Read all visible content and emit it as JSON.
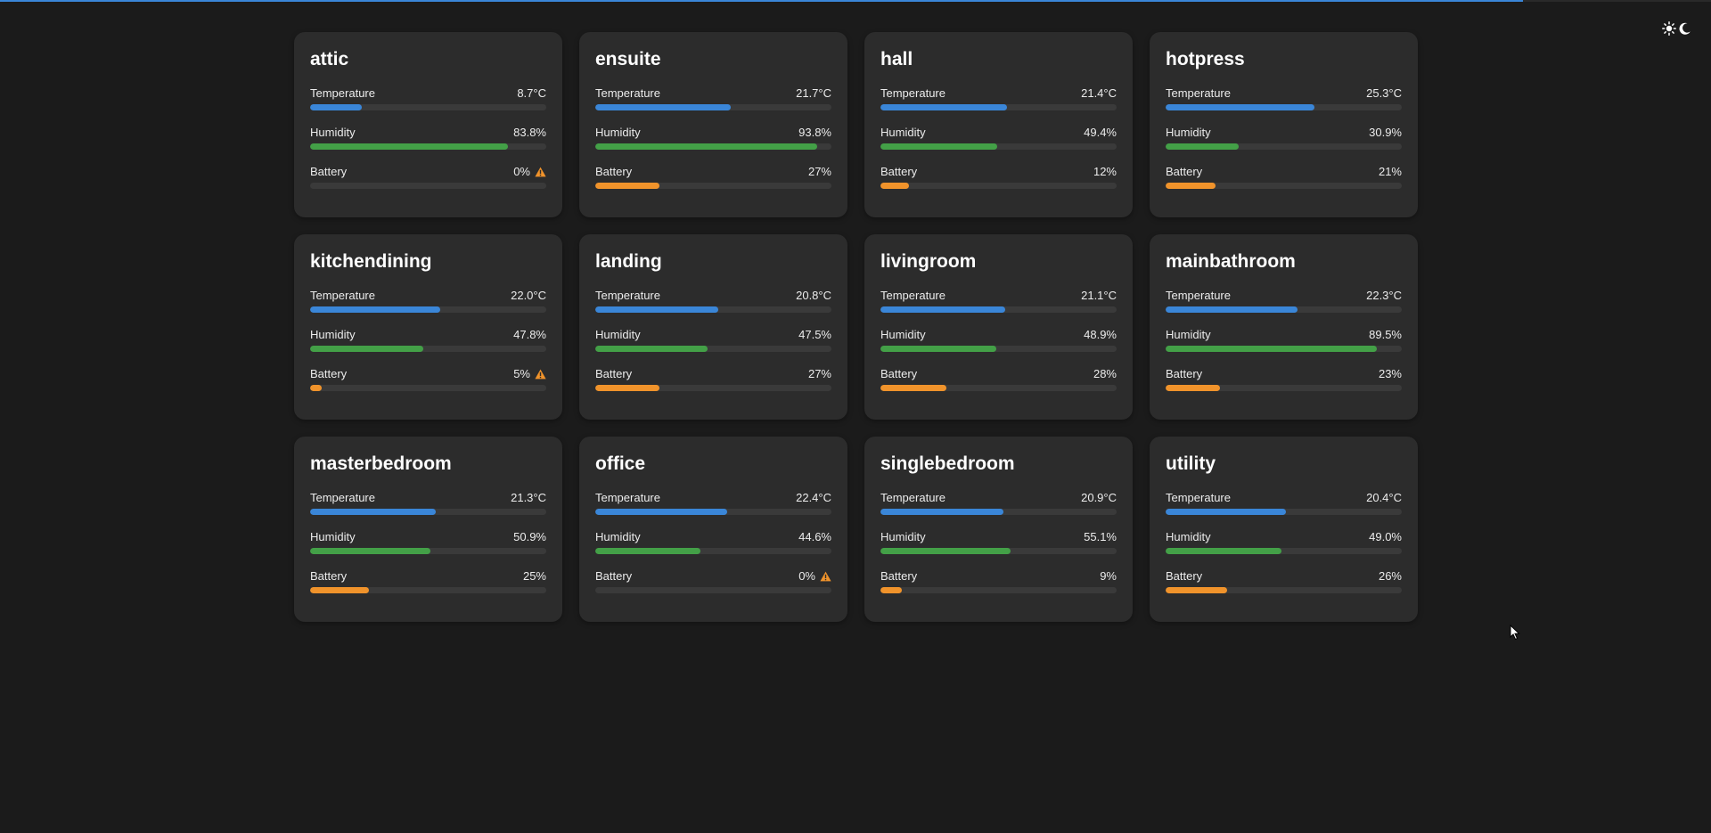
{
  "top_progress": {
    "percent": 89
  },
  "theme_toggle": {
    "icons": [
      "sun-icon",
      "moon-icon"
    ]
  },
  "colors": {
    "temperature": "#3a86d8",
    "humidity": "#43a047",
    "battery": "#f0932b",
    "warning": "#f0932b"
  },
  "labels": {
    "temperature": "Temperature",
    "humidity": "Humidity",
    "battery": "Battery"
  },
  "rooms": [
    {
      "name": "attic",
      "temperature": "8.7°C",
      "temperature_level": 0.22,
      "humidity": "83.8%",
      "humidity_level": 0.838,
      "battery": "0%",
      "battery_level": 0.0,
      "warning": true
    },
    {
      "name": "ensuite",
      "temperature": "21.7°C",
      "temperature_level": 0.575,
      "humidity": "93.8%",
      "humidity_level": 0.938,
      "battery": "27%",
      "battery_level": 0.27,
      "warning": false
    },
    {
      "name": "hall",
      "temperature": "21.4°C",
      "temperature_level": 0.535,
      "humidity": "49.4%",
      "humidity_level": 0.494,
      "battery": "12%",
      "battery_level": 0.12,
      "warning": false
    },
    {
      "name": "hotpress",
      "temperature": "25.3°C",
      "temperature_level": 0.63,
      "humidity": "30.9%",
      "humidity_level": 0.309,
      "battery": "21%",
      "battery_level": 0.21,
      "warning": false
    },
    {
      "name": "kitchendining",
      "temperature": "22.0°C",
      "temperature_level": 0.55,
      "humidity": "47.8%",
      "humidity_level": 0.478,
      "battery": "5%",
      "battery_level": 0.05,
      "warning": true
    },
    {
      "name": "landing",
      "temperature": "20.8°C",
      "temperature_level": 0.52,
      "humidity": "47.5%",
      "humidity_level": 0.475,
      "battery": "27%",
      "battery_level": 0.27,
      "warning": false
    },
    {
      "name": "livingroom",
      "temperature": "21.1°C",
      "temperature_level": 0.527,
      "humidity": "48.9%",
      "humidity_level": 0.489,
      "battery": "28%",
      "battery_level": 0.28,
      "warning": false
    },
    {
      "name": "mainbathroom",
      "temperature": "22.3°C",
      "temperature_level": 0.557,
      "humidity": "89.5%",
      "humidity_level": 0.895,
      "battery": "23%",
      "battery_level": 0.23,
      "warning": false
    },
    {
      "name": "masterbedroom",
      "temperature": "21.3°C",
      "temperature_level": 0.532,
      "humidity": "50.9%",
      "humidity_level": 0.509,
      "battery": "25%",
      "battery_level": 0.25,
      "warning": false
    },
    {
      "name": "office",
      "temperature": "22.4°C",
      "temperature_level": 0.56,
      "humidity": "44.6%",
      "humidity_level": 0.446,
      "battery": "0%",
      "battery_level": 0.0,
      "warning": true
    },
    {
      "name": "singlebedroom",
      "temperature": "20.9°C",
      "temperature_level": 0.522,
      "humidity": "55.1%",
      "humidity_level": 0.551,
      "battery": "9%",
      "battery_level": 0.09,
      "warning": false
    },
    {
      "name": "utility",
      "temperature": "20.4°C",
      "temperature_level": 0.51,
      "humidity": "49.0%",
      "humidity_level": 0.49,
      "battery": "26%",
      "battery_level": 0.26,
      "warning": false
    }
  ]
}
